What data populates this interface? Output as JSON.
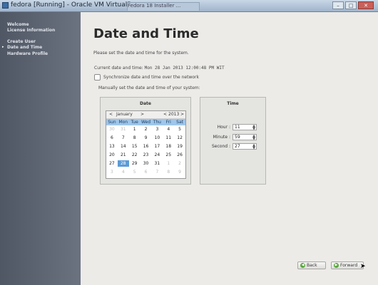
{
  "window": {
    "title": "fedora [Running] - Oracle VM VirtualBox",
    "tab_text": "Fedora 18 Installer ...",
    "buttons": [
      "–",
      "□",
      "✕"
    ]
  },
  "sidebar": {
    "items": [
      {
        "label": "Welcome"
      },
      {
        "label": "License Information"
      },
      {
        "label": "Create User"
      },
      {
        "label": "Date and Time",
        "current": true
      },
      {
        "label": "Hardware Profile"
      }
    ],
    "arrow": "▸"
  },
  "page": {
    "title": "Date and Time",
    "description": "Please set the date and time for the system.",
    "current_label": "Current date and time:",
    "current_value": "Mon 28 Jan 2013 12:00:48 PM WIT",
    "sync_label": "Synchronize date and time over the network",
    "sync_checked": false,
    "manual_label": "Manually set the date and time of your system:"
  },
  "date": {
    "frame_title": "Date",
    "month": "January",
    "year": "2013",
    "prev_arrow": "<",
    "next_arrow": ">",
    "weekdays": [
      "Sun",
      "Mon",
      "Tue",
      "Wed",
      "Thu",
      "Fri",
      "Sat"
    ],
    "weeks": [
      [
        "30",
        "31",
        "1",
        "2",
        "3",
        "4",
        "5"
      ],
      [
        "6",
        "7",
        "8",
        "9",
        "10",
        "11",
        "12"
      ],
      [
        "13",
        "14",
        "15",
        "16",
        "17",
        "18",
        "19"
      ],
      [
        "20",
        "21",
        "22",
        "23",
        "24",
        "25",
        "26"
      ],
      [
        "27",
        "28",
        "29",
        "30",
        "31",
        "1",
        "2"
      ],
      [
        "3",
        "4",
        "5",
        "6",
        "7",
        "8",
        "9"
      ]
    ],
    "selected_day": "28"
  },
  "time": {
    "frame_title": "Time",
    "fields": [
      {
        "label": "Hour :",
        "value": "11"
      },
      {
        "label": "Minute :",
        "value": "59"
      },
      {
        "label": "Second :",
        "value": "27"
      }
    ]
  },
  "navigation": {
    "back_label": "Back",
    "forward_label": "Forward"
  },
  "colors": {
    "sidebar": "#5e6571",
    "selected_day": "#5c9bd7",
    "weekday_header": "#9fc6ea"
  }
}
